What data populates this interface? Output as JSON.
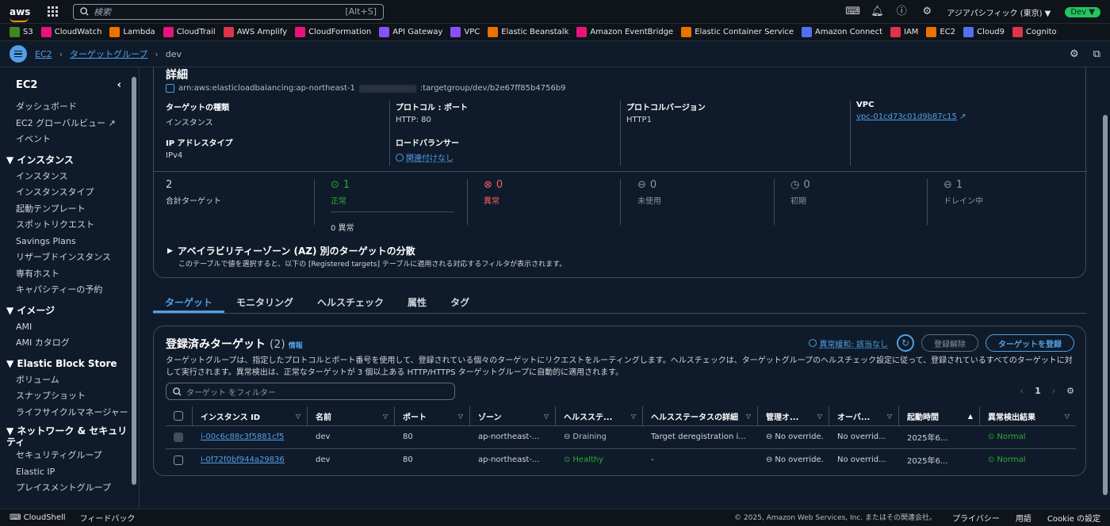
{
  "topnav": {
    "logo": "aws",
    "search_placeholder": "検索",
    "search_shortcut": "[Alt+S]",
    "region": "アジアパシフィック (東京) ▼",
    "env": "Dev ▼"
  },
  "favorites": [
    {
      "label": "S3",
      "color": "#3f8624"
    },
    {
      "label": "CloudWatch",
      "color": "#e7157b"
    },
    {
      "label": "Lambda",
      "color": "#ed7100"
    },
    {
      "label": "CloudTrail",
      "color": "#e7157b"
    },
    {
      "label": "AWS Amplify",
      "color": "#dd344c"
    },
    {
      "label": "CloudFormation",
      "color": "#e7157b"
    },
    {
      "label": "API Gateway",
      "color": "#8c4fff"
    },
    {
      "label": "VPC",
      "color": "#8c4fff"
    },
    {
      "label": "Elastic Beanstalk",
      "color": "#ed7100"
    },
    {
      "label": "Amazon EventBridge",
      "color": "#e7157b"
    },
    {
      "label": "Elastic Container Service",
      "color": "#ed7100"
    },
    {
      "label": "Amazon Connect",
      "color": "#4d72f3"
    },
    {
      "label": "IAM",
      "color": "#dd344c"
    },
    {
      "label": "EC2",
      "color": "#ed7100"
    },
    {
      "label": "Cloud9",
      "color": "#4d72f3"
    },
    {
      "label": "Cognito",
      "color": "#dd344c"
    }
  ],
  "breadcrumb": {
    "item1": "EC2",
    "item2": "ターゲットグループ",
    "current": "dev"
  },
  "sidebar": {
    "title": "EC2",
    "top_items": [
      "ダッシュボード",
      "EC2 グローバルビュー",
      "イベント"
    ],
    "sections": [
      {
        "title": "▼ インスタンス",
        "items": [
          "インスタンス",
          "インスタンスタイプ",
          "起動テンプレート",
          "スポットリクエスト",
          "Savings Plans",
          "リザーブドインスタンス",
          "専有ホスト",
          "キャパシティーの予約"
        ]
      },
      {
        "title": "▼ イメージ",
        "items": [
          "AMI",
          "AMI カタログ"
        ]
      },
      {
        "title": "▼ Elastic Block Store",
        "items": [
          "ボリューム",
          "スナップショット",
          "ライフサイクルマネージャー"
        ]
      },
      {
        "title": "▼ ネットワーク & セキュリティ",
        "items": [
          "セキュリティグループ",
          "Elastic IP",
          "プレイスメントグループ"
        ]
      }
    ]
  },
  "details": {
    "title": "詳細",
    "arn_prefix": "arn:aws:elasticloadbalancing:ap-northeast-1",
    "arn_suffix": ":targetgroup/dev/b2e67ff85b4756b9",
    "target_type_label": "ターゲットの種類",
    "target_type_value": "インスタンス",
    "protocol_label": "プロトコル : ポート",
    "protocol_value": "HTTP: 80",
    "protocol_version_label": "プロトコルバージョン",
    "protocol_version_value": "HTTP1",
    "vpc_label": "VPC",
    "vpc_value": "vpc-01cd73c01d9b87c15",
    "ip_type_label": "IP アドレスタイプ",
    "ip_type_value": "IPv4",
    "lb_label": "ロードバランサー",
    "lb_value": "関連付けなし"
  },
  "stats": {
    "total_num": "2",
    "total_label": "合計ターゲット",
    "healthy_num": "1",
    "healthy_label": "正常",
    "healthy_sub": "0 異常",
    "unhealthy_num": "0",
    "unhealthy_label": "異常",
    "unused_num": "0",
    "unused_label": "未使用",
    "initial_num": "0",
    "initial_label": "初期",
    "drain_num": "1",
    "drain_label": "ドレイン中"
  },
  "az": {
    "title": "アベイラビリティーゾーン (AZ) 別のターゲットの分散",
    "desc": "このテーブルで値を選択すると、以下の [Registered targets] テーブルに適用される対応するフィルタが表示されます。"
  },
  "tabs": [
    "ターゲット",
    "モニタリング",
    "ヘルスチェック",
    "属性",
    "タグ"
  ],
  "targets": {
    "title": "登録済みターゲット",
    "count": "(2)",
    "info": "情報",
    "anomaly": "異常緩和: 該当なし",
    "deregister": "登録解除",
    "register": "ターゲットを登録",
    "desc": "ターゲットグループは、指定したプロトコルとポート番号を使用して、登録されている個々のターゲットにリクエストをルーティングします。ヘルスチェックは、ターゲットグループのヘルスチェック設定に従って、登録されているすべてのターゲットに対して実行されます。異常検出は、正常なターゲットが 3 個以上ある HTTP/HTTPS ターゲットグループに自動的に適用されます。",
    "filter_placeholder": "ターゲット をフィルター",
    "page": "1",
    "columns": [
      "インスタンス ID",
      "名前",
      "ポート",
      "ゾーン",
      "ヘルスステ...",
      "ヘルスステータスの詳細",
      "管理オ...",
      "オーバ...",
      "起動時間",
      "異常検出結果"
    ],
    "rows": [
      {
        "id": "i-00c6c88c3f5881cf5",
        "name": "dev",
        "port": "80",
        "zone": "ap-northeast-...",
        "health": "Draining",
        "detail": "Target deregistration i...",
        "admin": "No override.",
        "override": "No overrid...",
        "launch": "2025年6...",
        "anomaly": "Normal"
      },
      {
        "id": "i-0f72f0bf944a29836",
        "name": "dev",
        "port": "80",
        "zone": "ap-northeast-...",
        "health": "Healthy",
        "detail": "-",
        "admin": "No override.",
        "override": "No overrid...",
        "launch": "2025年6...",
        "anomaly": "Normal"
      }
    ]
  },
  "footer": {
    "cloudshell": "CloudShell",
    "feedback": "フィードバック",
    "copyright": "© 2025, Amazon Web Services, Inc. またはその関連会社。",
    "privacy": "プライバシー",
    "terms": "用語",
    "cookie": "Cookie の設定"
  }
}
